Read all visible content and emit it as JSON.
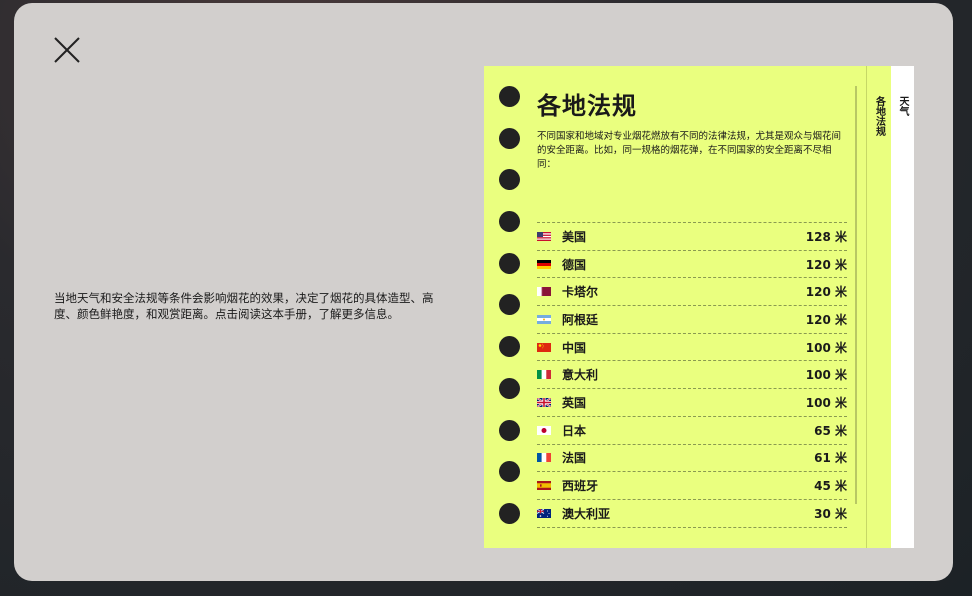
{
  "intro_text": "当地天气和安全法规等条件会影响烟花的效果，决定了烟花的具体造型、高度、颜色鲜艳度，和观赏距离。点击阅读这本手册，了解更多信息。",
  "close_icon": "close-icon",
  "tabs": [
    {
      "label": "各地法规"
    },
    {
      "label": "天气"
    }
  ],
  "page": {
    "title": "各地法规",
    "description": "不同国家和地域对专业烟花燃放有不同的法律法规，尤其是观众与烟花间的安全距离。比如，同一规格的烟花弹，在不同国家的安全距离不尽相同：",
    "rows": [
      {
        "country": "美国",
        "distance": "128 米",
        "flag": "us-flag-icon"
      },
      {
        "country": "德国",
        "distance": "120 米",
        "flag": "de-flag-icon"
      },
      {
        "country": "卡塔尔",
        "distance": "120 米",
        "flag": "qa-flag-icon"
      },
      {
        "country": "阿根廷",
        "distance": "120 米",
        "flag": "ar-flag-icon"
      },
      {
        "country": "中国",
        "distance": "100 米",
        "flag": "cn-flag-icon"
      },
      {
        "country": "意大利",
        "distance": "100 米",
        "flag": "it-flag-icon"
      },
      {
        "country": "英国",
        "distance": "100 米",
        "flag": "gb-flag-icon"
      },
      {
        "country": "日本",
        "distance": "65 米",
        "flag": "jp-flag-icon"
      },
      {
        "country": "法国",
        "distance": "61 米",
        "flag": "fr-flag-icon"
      },
      {
        "country": "西班牙",
        "distance": "45 米",
        "flag": "es-flag-icon"
      },
      {
        "country": "澳大利亚",
        "distance": "30 米",
        "flag": "au-flag-icon"
      }
    ]
  },
  "colors": {
    "page_bg": "#eaff7f",
    "modal_bg": "#d2cfcd",
    "hole": "#222222"
  }
}
